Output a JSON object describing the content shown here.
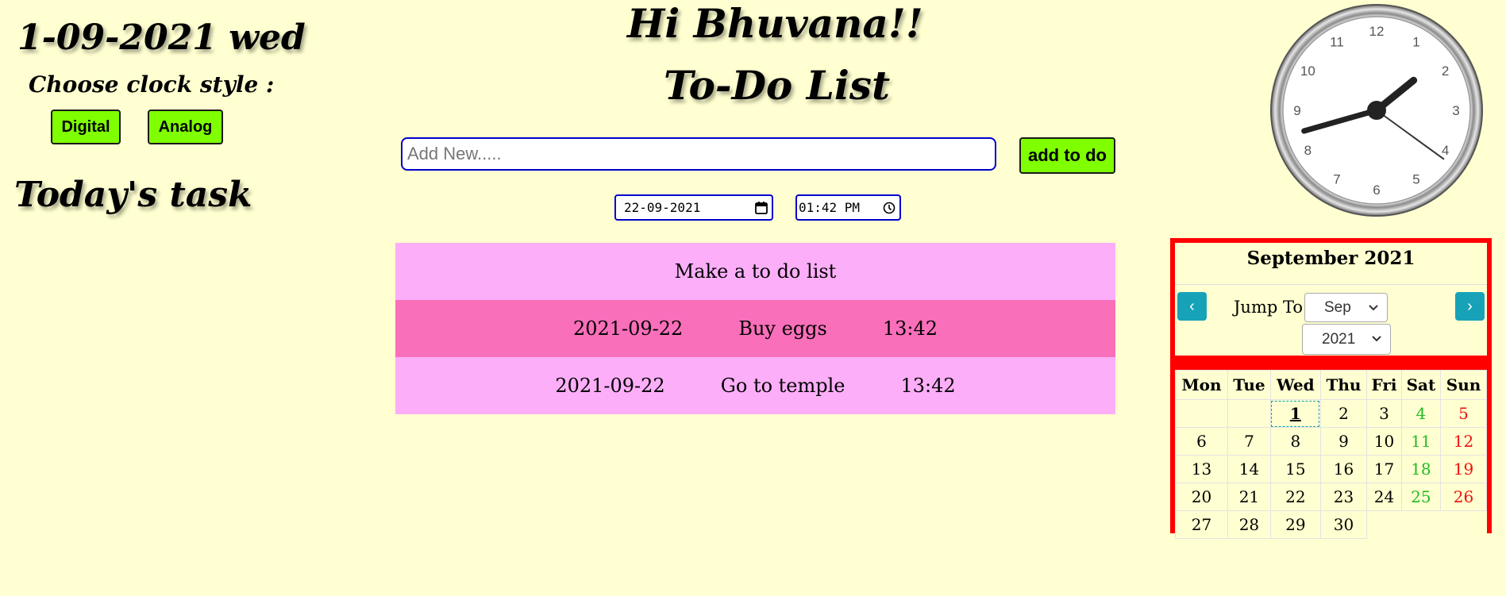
{
  "left": {
    "date": "1-09-2021 wed",
    "clock_style_label": "Choose clock style :",
    "buttons": {
      "digital": "Digital",
      "analog": "Analog"
    },
    "todays_task": "Today's task"
  },
  "header": {
    "greeting": "Hi    Bhuvana!!",
    "title": "To-Do List"
  },
  "form": {
    "placeholder": "Add New.....",
    "add_label": "add to do",
    "date_value": "22-09-2021",
    "time_value": "01:42 PM"
  },
  "todos": [
    {
      "text": "Make a to do list",
      "date": "",
      "time": ""
    },
    {
      "date": "2021-09-22",
      "text": "Buy eggs",
      "time": "13:42"
    },
    {
      "date": "2021-09-22",
      "text": "Go to temple",
      "time": "13:42"
    }
  ],
  "clock": {
    "hour": 1,
    "minute": 42,
    "second": 21
  },
  "calendar": {
    "title": "September 2021",
    "jump_label": "Jump To:",
    "month_value": "Sep",
    "year_value": "2021",
    "prev": "‹",
    "next": "›",
    "weekdays": [
      "Mon",
      "Tue",
      "Wed",
      "Thu",
      "Fri",
      "Sat",
      "Sun"
    ],
    "weeks": [
      [
        "",
        "",
        "1",
        "2",
        "3",
        "4",
        "5"
      ],
      [
        "6",
        "7",
        "8",
        "9",
        "10",
        "11",
        "12"
      ],
      [
        "13",
        "14",
        "15",
        "16",
        "17",
        "18",
        "19"
      ],
      [
        "20",
        "21",
        "22",
        "23",
        "24",
        "25",
        "26"
      ],
      [
        "27",
        "28",
        "29",
        "30",
        "",
        "",
        ""
      ]
    ],
    "today": "1"
  },
  "colors": {
    "background": "#ffffd1",
    "button_green": "#7fff00",
    "todo_light": "#fcaef8",
    "todo_dark": "#f96fba",
    "calendar_border": "#ff0000",
    "nav_teal": "#17a2b8",
    "saturday": "#22bb22",
    "sunday": "#ee1111"
  },
  "icons": {
    "date_picker": "calendar-icon",
    "time_picker": "clock-icon",
    "select_arrow": "chevron-down-icon"
  }
}
